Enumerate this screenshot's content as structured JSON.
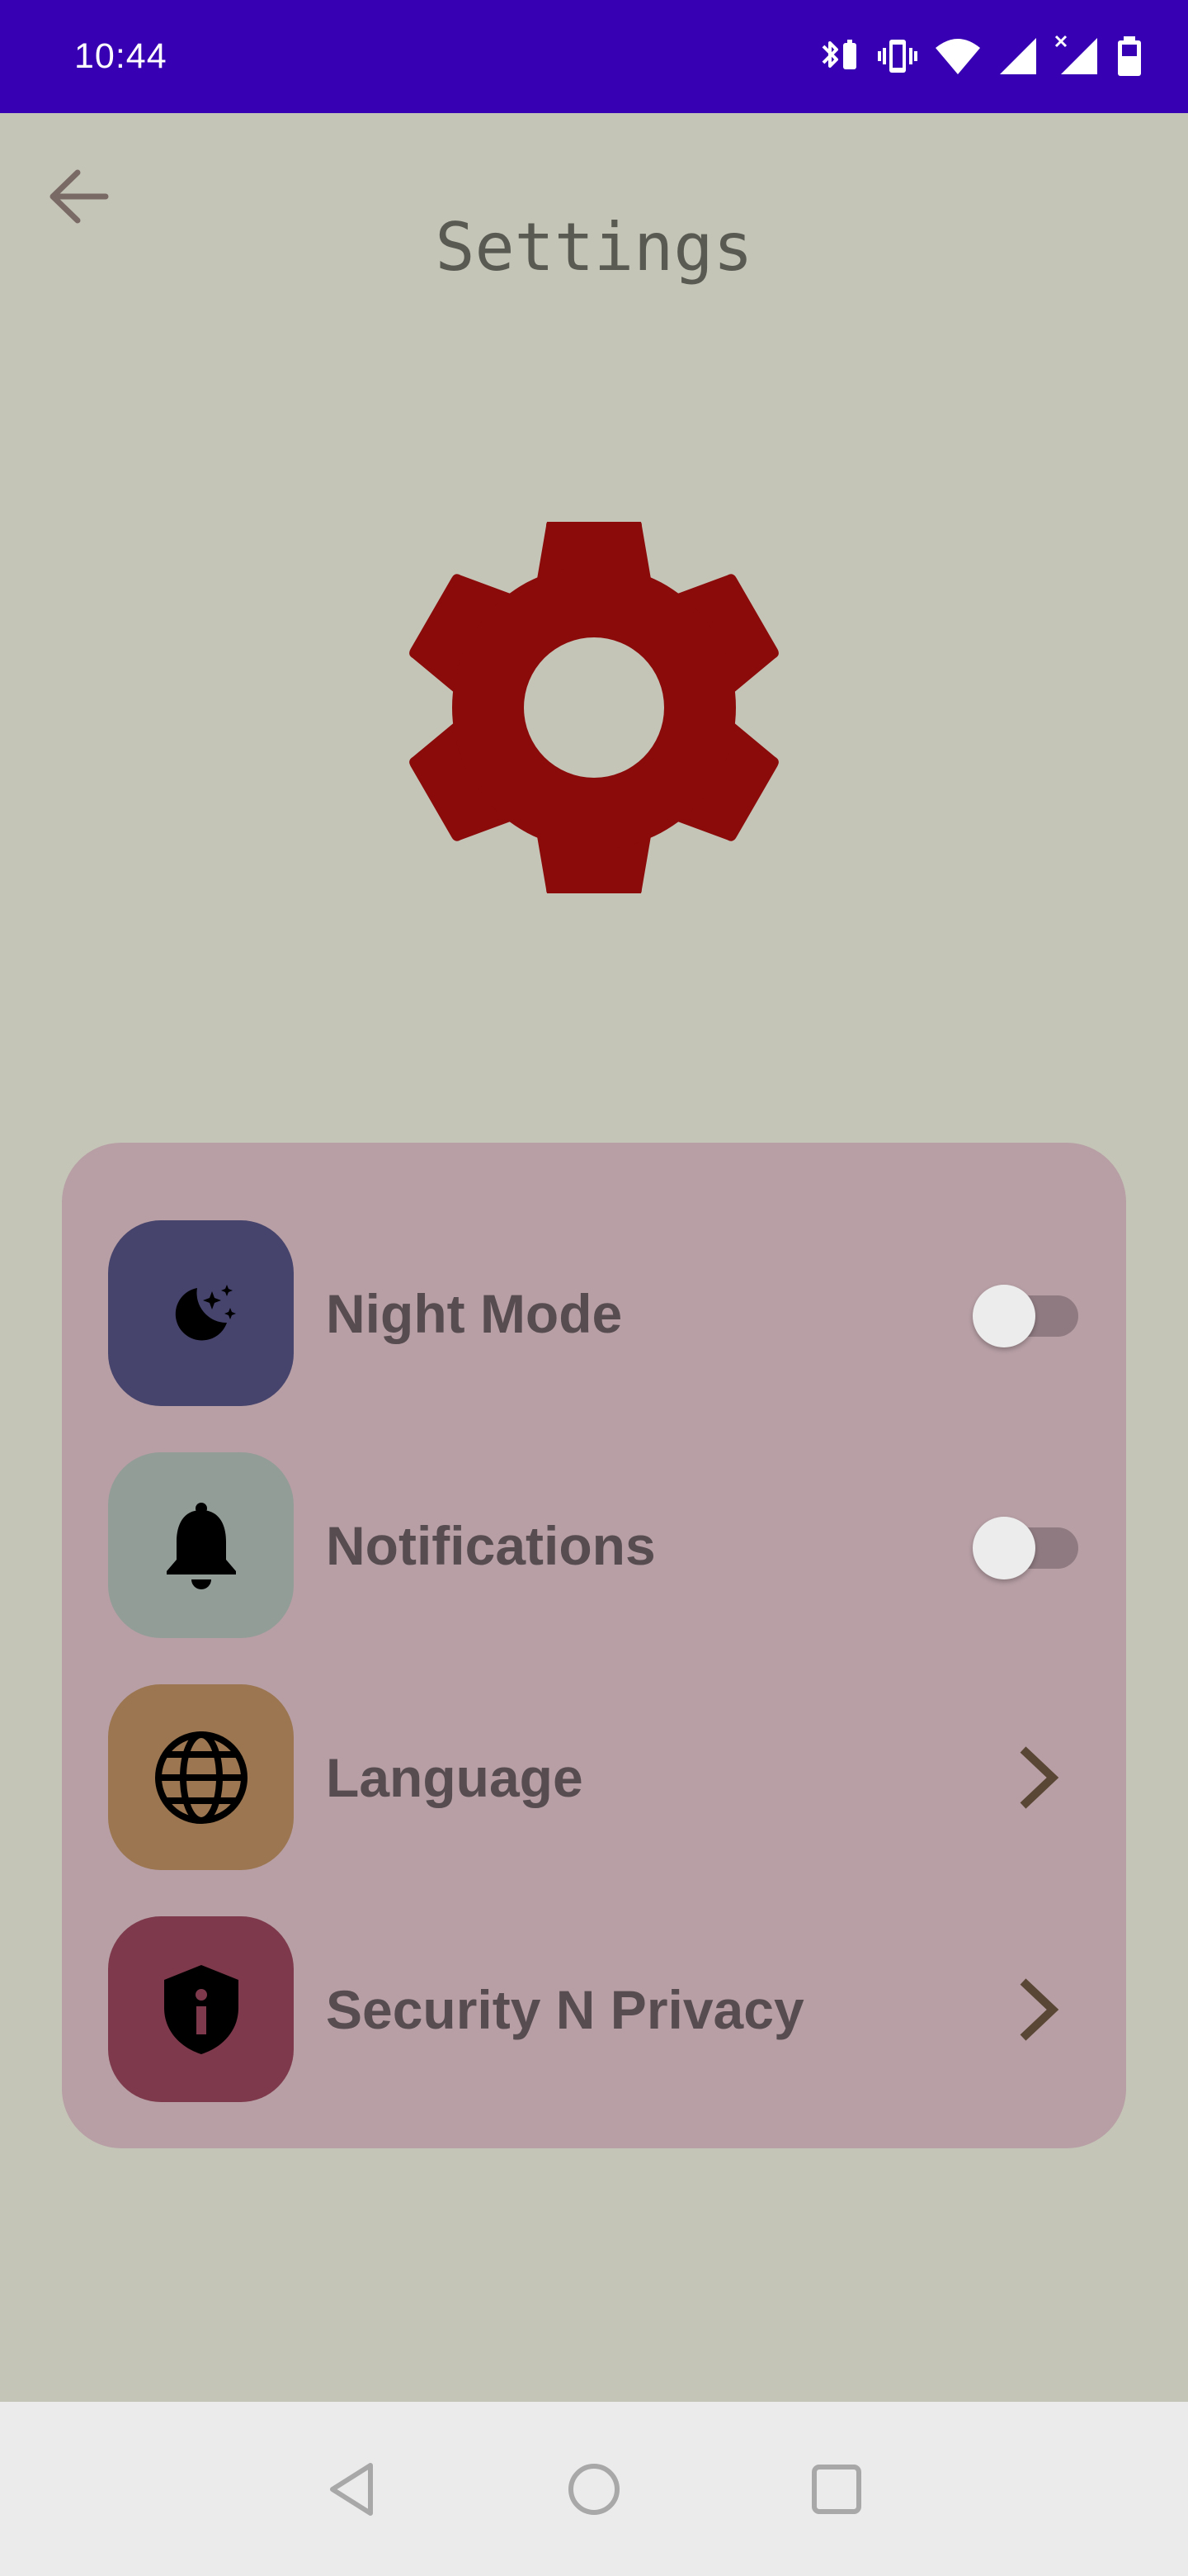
{
  "status_bar": {
    "time": "10:44",
    "icons": [
      "bluetooth-battery-icon",
      "vibrate-icon",
      "wifi-icon",
      "signal-icon",
      "signal-no-data-icon",
      "battery-icon"
    ],
    "background": "#3700b3"
  },
  "header": {
    "title": "Settings",
    "back_icon": "arrow-left-icon"
  },
  "hero": {
    "icon": "gear-icon",
    "color": "#8b0a0a"
  },
  "settings": {
    "items": [
      {
        "label": "Night Mode",
        "icon": "moon-stars-icon",
        "tile_color": "#46446c",
        "control": "toggle",
        "enabled": false
      },
      {
        "label": "Notifications",
        "icon": "bell-icon",
        "tile_color": "#939d98",
        "control": "toggle",
        "enabled": false
      },
      {
        "label": "Language",
        "icon": "globe-icon",
        "tile_color": "#9b7650",
        "control": "chevron"
      },
      {
        "label": "Security N Privacy",
        "icon": "shield-info-icon",
        "tile_color": "#7e3a4c",
        "control": "chevron"
      }
    ],
    "card_color": "#b79fa5"
  },
  "nav_bar": {
    "buttons": [
      "back-triangle-icon",
      "home-circle-icon",
      "recents-square-icon"
    ]
  }
}
